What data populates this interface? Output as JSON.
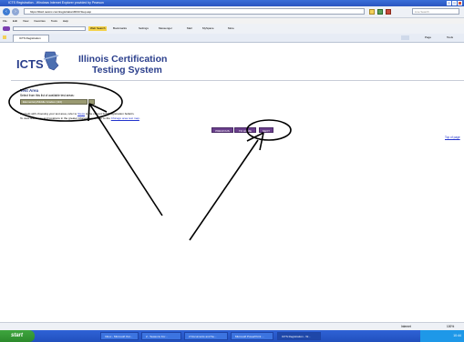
{
  "window": {
    "title": "ICTS Registration - Windows Internet Explorer provided by Pearson"
  },
  "address": {
    "url": "https://iltsi2.nesinc.com/iregistration/RI03.Step.asp",
    "search_placeholder": "Live Search"
  },
  "menu": [
    "File",
    "Edit",
    "View",
    "Favorites",
    "Tools",
    "Help"
  ],
  "toolbar": {
    "search_label": "Web Search",
    "bookmarks_label": "Bookmarks",
    "settings_label": "Settings",
    "messenger_label": "Messenger",
    "mail_label": "Mail",
    "myspace_label": "MySpace",
    "more_label": "More"
  },
  "tab": {
    "label": "ICTS Registration",
    "page_btn": "Page",
    "tools_btn": "Tools"
  },
  "page": {
    "logo": "ICTS",
    "brand_line1": "Illinois Certification",
    "brand_line2": "Testing System",
    "test_area_heading": "Test Area",
    "test_area_sub": "Select from this list of available test areas:",
    "select_value": "Elementary/Middle Grades (110)",
    "help_line1_a": "For help with choosing your test area, refer to ",
    "help_link1": "Steps",
    "help_line1_b": " is the current ICTS registration bulletin.",
    "help_line2_a": "To view test areas and locations in the greater Chicago area, refer to the ",
    "help_link2": "Chicago area test map",
    "help_line2_b": ".",
    "btn_previous": "PREVIOUS",
    "btn_home": "TO HOME",
    "btn_next": "NEXT",
    "top_link": "Top of page"
  },
  "status": {
    "zone": "Internet",
    "zoom": "100%"
  },
  "taskbar": {
    "start": "start",
    "tasks": [
      "Inbox - Microsoft Out...",
      "2 - Seasons For...",
      "2 Documents and Se...",
      "Microsoft PowerPoint ...",
      "ICTS Registration - W..."
    ],
    "clock": "10:44"
  }
}
